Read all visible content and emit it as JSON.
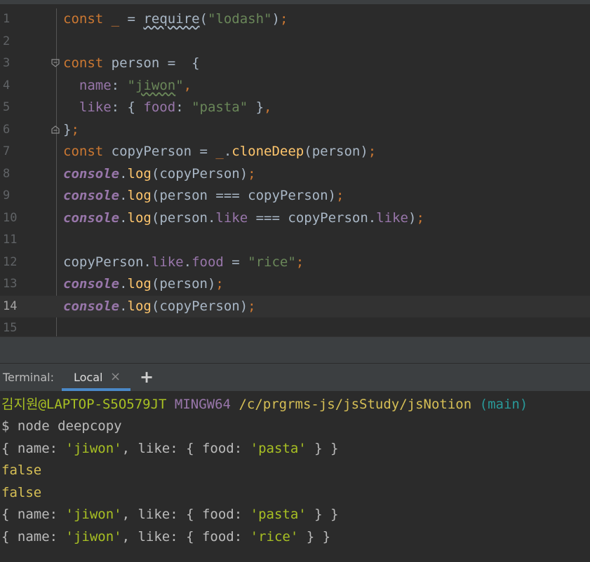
{
  "editor": {
    "current_line": 14,
    "line_numbers": [
      "1",
      "2",
      "3",
      "4",
      "5",
      "6",
      "7",
      "8",
      "9",
      "10",
      "11",
      "12",
      "13",
      "14",
      "15"
    ],
    "tokens": {
      "const": "const",
      "underscore": "_",
      "eq": " = ",
      "require": "require",
      "lodash_str": "\"lodash\"",
      "person": "person",
      "open_brace": " {",
      "name_key": "name",
      "jiwon_str_open": "\"",
      "jiwon_word": "jiwon",
      "jiwon_str_close": "\"",
      "like_key": "like",
      "food_key": "food",
      "pasta_str": "\"pasta\"",
      "close_brace": "}",
      "copyPerson": "copyPerson",
      "cloneDeep": "cloneDeep",
      "console": "console",
      "log": "log",
      "triple_eq": " === ",
      "rice_str": "\"rice\""
    }
  },
  "terminal": {
    "label": "Terminal:",
    "tab_label": "Local",
    "close_glyph": "×",
    "add_glyph": "+",
    "prompt_user": "김지원@LAPTOP-S5O579JT",
    "prompt_env": "MINGW64",
    "prompt_path": "/c/prgrms-js/jsStudy/jsNotion",
    "prompt_branch": "(main)",
    "command": "$ node deepcopy",
    "out_false": "false",
    "obj_prefix": "{ name: ",
    "obj_name_val": "'jiwon'",
    "obj_mid": ", like: { food: ",
    "obj_pasta": "'pasta'",
    "obj_rice": "'rice'",
    "obj_suffix": " } }"
  }
}
